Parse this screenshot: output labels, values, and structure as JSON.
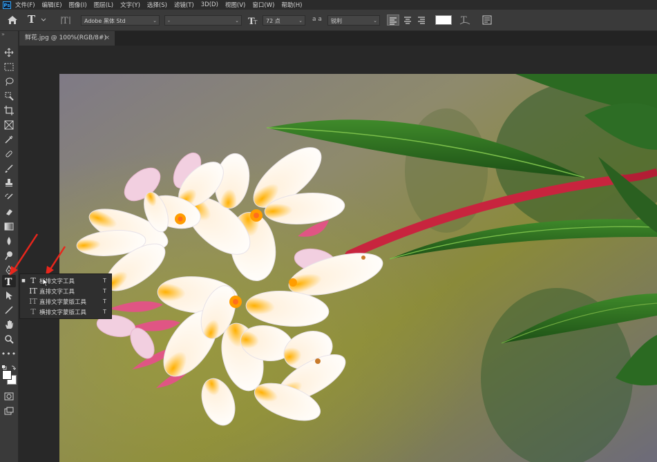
{
  "menubar": {
    "logo": "Ps",
    "items": [
      "文件(F)",
      "编辑(E)",
      "图像(I)",
      "图层(L)",
      "文字(Y)",
      "选择(S)",
      "滤镜(T)",
      "3D(D)",
      "视图(V)",
      "窗口(W)",
      "帮助(H)"
    ]
  },
  "options": {
    "font_family": "Adobe 黑体 Std",
    "font_style": "-",
    "font_size": "72 点",
    "aa_label": "a a",
    "anti_alias": "锐利",
    "text_color": "#ffffff"
  },
  "document": {
    "tab_title": "鲜花.jpg @ 100%(RGB/8#)",
    "close": "×"
  },
  "flyout": {
    "items": [
      {
        "label": "横排文字工具",
        "shortcut": "T",
        "icon": "T",
        "selected": true
      },
      {
        "label": "直排文字工具",
        "shortcut": "T",
        "icon": "IT",
        "selected": false
      },
      {
        "label": "直排文字蒙版工具",
        "shortcut": "T",
        "icon": "IT",
        "selected": false
      },
      {
        "label": "横排文字蒙版工具",
        "shortcut": "T",
        "icon": "T",
        "selected": false
      }
    ]
  },
  "colors": {
    "accent": "#31a8ff",
    "annotation_arrow": "#e8261c"
  }
}
